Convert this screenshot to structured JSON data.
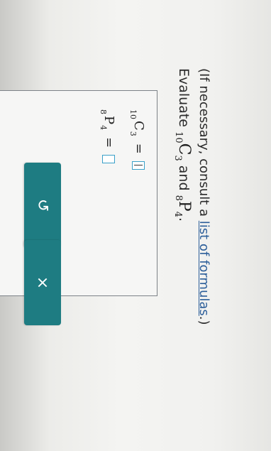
{
  "question": {
    "lead": "Evaluate",
    "combination": {
      "n": "10",
      "symbol": "C",
      "r": "3"
    },
    "conjunction": "and",
    "permutation": {
      "n": "8",
      "symbol": "P",
      "r": "4"
    },
    "end": "."
  },
  "hint": {
    "before": "(If necessary, consult a ",
    "link": "list of formulas",
    "after": ".)"
  },
  "answers": [
    {
      "n": "10",
      "symbol": "C",
      "r": "3",
      "equals": "=",
      "value": ""
    },
    {
      "n": "8",
      "symbol": "P",
      "r": "4",
      "equals": "=",
      "value": ""
    }
  ],
  "buttons": {
    "clear_label": "×",
    "undo_label": "↺"
  },
  "colors": {
    "button": "#1e7c82",
    "input_border": "#39a0c8",
    "link": "#2d5f9a"
  }
}
